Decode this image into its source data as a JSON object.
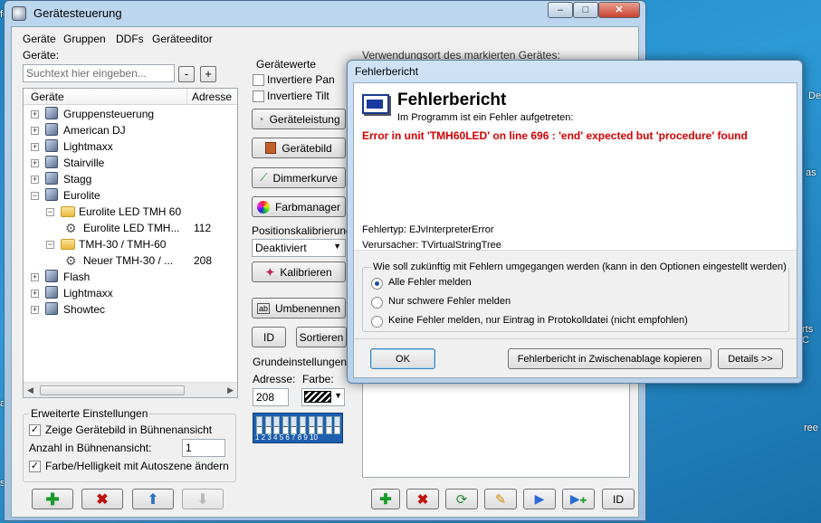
{
  "desktop": {
    "edge_texts": [
      "fc",
      "De",
      "as",
      "rts C",
      "as",
      "s",
      "ree"
    ]
  },
  "window": {
    "title": "Gerätesteuerung",
    "controls": [
      "–",
      "□",
      "✕"
    ]
  },
  "menu": [
    "Geräte",
    "Gruppen",
    "DDFs",
    "Geräteeditor"
  ],
  "left": {
    "devices_label": "Geräte:",
    "search_placeholder": "Suchtext hier eingeben...",
    "minus": "-",
    "plus": "+",
    "tree_headers": [
      "Geräte",
      "Adresse"
    ],
    "tree": [
      {
        "label": "Gruppensteuerung",
        "address": "",
        "level": 0,
        "expander": "+",
        "icon": "cube-icon"
      },
      {
        "label": "American DJ",
        "address": "",
        "level": 0,
        "expander": "+",
        "icon": "cube-icon"
      },
      {
        "label": "Lightmaxx",
        "address": "",
        "level": 0,
        "expander": "+",
        "icon": "cube-icon"
      },
      {
        "label": "Stairville",
        "address": "",
        "level": 0,
        "expander": "+",
        "icon": "cube-icon"
      },
      {
        "label": "Stagg",
        "address": "",
        "level": 0,
        "expander": "+",
        "icon": "cube-icon"
      },
      {
        "label": "Eurolite",
        "address": "",
        "level": 0,
        "expander": "−",
        "icon": "cube-icon"
      },
      {
        "label": "Eurolite LED TMH 60",
        "address": "",
        "level": 1,
        "expander": "−",
        "icon": "folder-icon"
      },
      {
        "label": "Eurolite LED TMH...",
        "address": "112",
        "level": 2,
        "expander": "",
        "icon": "moving-head-icon"
      },
      {
        "label": "TMH-30 / TMH-60",
        "address": "",
        "level": 1,
        "expander": "−",
        "icon": "folder-icon"
      },
      {
        "label": "Neuer TMH-30 / ...",
        "address": "208",
        "level": 2,
        "expander": "",
        "icon": "moving-head-icon"
      },
      {
        "label": "Flash",
        "address": "",
        "level": 0,
        "expander": "+",
        "icon": "cube-icon"
      },
      {
        "label": "Lightmaxx",
        "address": "",
        "level": 0,
        "expander": "+",
        "icon": "cube-icon"
      },
      {
        "label": "Showtec",
        "address": "",
        "level": 0,
        "expander": "+",
        "icon": "cube-icon"
      }
    ],
    "advanced": {
      "title": "Erweiterte Einstellungen",
      "show_image": "Zeige Gerätebild in Bühnenansicht",
      "count_label": "Anzahl in Bühnenansicht:",
      "count_value": "1",
      "color_autoscene": "Farbe/Helligkeit mit Autoszene ändern"
    }
  },
  "middle": {
    "values_title": "Gerätewerte",
    "invert_pan": "Invertiere Pan",
    "invert_tilt": "Invertiere Tilt",
    "buttons": [
      "Geräteleistung",
      "Gerätebild",
      "Dimmerkurve",
      "Farbmanager"
    ],
    "pos_label": "Positionskalibrierung:",
    "pos_value": "Deaktiviert",
    "calibrate": "Kalibrieren",
    "rename": "Umbenennen",
    "id": "ID",
    "sort": "Sortieren",
    "basic_title": "Grundeinstellungen",
    "address_label": "Adresse:",
    "address_value": "208",
    "color_label": "Farbe:",
    "dip_numbers": "1 2 3 4 5 6 7 8 9 10",
    "dip_on": "ON"
  },
  "right": {
    "usage_label": "Verwendungsort des markierten Gerätes:",
    "bottom_id": "ID"
  },
  "dialog": {
    "title": "Fehlerbericht",
    "heading": "Fehlerbericht",
    "subheading": "Im Programm ist ein Fehler aufgetreten:",
    "error": "Error in unit 'TMH60LED' on line 696 : 'end' expected but 'procedure' found",
    "type": "Fehlertyp: EJvInterpreterError",
    "cause": "Verursacher: TVirtualStringTree",
    "group_title": "Wie soll zukünftig mit Fehlern umgegangen werden (kann in den Optionen eingestellt werden)",
    "options": [
      "Alle Fehler melden",
      "Nur schwere Fehler melden",
      "Keine Fehler melden, nur Eintrag in Protokolldatei (nicht empfohlen)"
    ],
    "ok": "OK",
    "copy": "Fehlerbericht in Zwischenablage kopieren",
    "details": "Details >>"
  },
  "colors": {
    "error_red": "#d40000",
    "accent_blue": "#1a4fa0"
  }
}
